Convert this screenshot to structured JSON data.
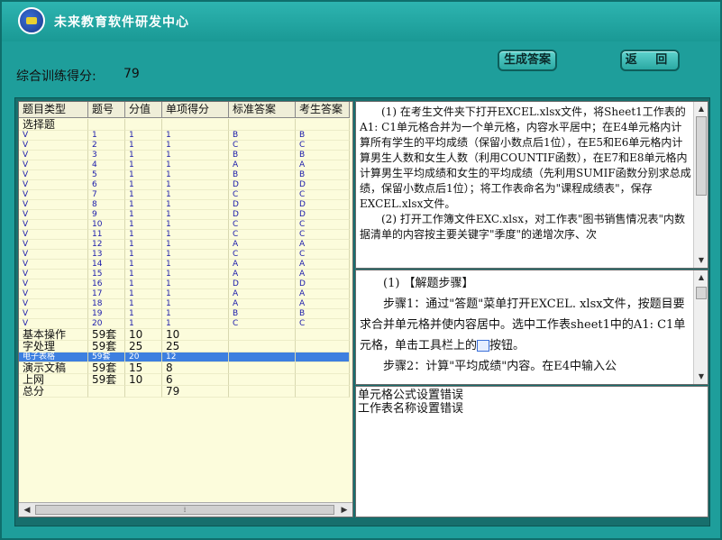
{
  "app": {
    "title": "未来教育软件研发中心"
  },
  "score": {
    "label": "综合训练得分:",
    "value": "79"
  },
  "toolbar": {
    "generate_label": "生成答案",
    "return_label": "返 回"
  },
  "grid": {
    "columns": [
      "题目类型",
      "题号",
      "分值",
      "单项得分",
      "标准答案",
      "考生答案"
    ],
    "rows": [
      {
        "type": "选择题",
        "num": "",
        "score": "",
        "got": "",
        "std": "",
        "ans": "",
        "kind": "cat"
      },
      {
        "type": "V",
        "num": "1",
        "score": "1",
        "got": "1",
        "std": "B",
        "ans": "B",
        "kind": "sub"
      },
      {
        "type": "V",
        "num": "2",
        "score": "1",
        "got": "1",
        "std": "C",
        "ans": "C",
        "kind": "sub"
      },
      {
        "type": "V",
        "num": "3",
        "score": "1",
        "got": "1",
        "std": "B",
        "ans": "B",
        "kind": "sub"
      },
      {
        "type": "V",
        "num": "4",
        "score": "1",
        "got": "1",
        "std": "A",
        "ans": "A",
        "kind": "sub"
      },
      {
        "type": "V",
        "num": "5",
        "score": "1",
        "got": "1",
        "std": "B",
        "ans": "B",
        "kind": "sub"
      },
      {
        "type": "V",
        "num": "6",
        "score": "1",
        "got": "1",
        "std": "D",
        "ans": "D",
        "kind": "sub"
      },
      {
        "type": "V",
        "num": "7",
        "score": "1",
        "got": "1",
        "std": "C",
        "ans": "C",
        "kind": "sub"
      },
      {
        "type": "V",
        "num": "8",
        "score": "1",
        "got": "1",
        "std": "D",
        "ans": "D",
        "kind": "sub"
      },
      {
        "type": "V",
        "num": "9",
        "score": "1",
        "got": "1",
        "std": "D",
        "ans": "D",
        "kind": "sub"
      },
      {
        "type": "V",
        "num": "10",
        "score": "1",
        "got": "1",
        "std": "C",
        "ans": "C",
        "kind": "sub"
      },
      {
        "type": "V",
        "num": "11",
        "score": "1",
        "got": "1",
        "std": "C",
        "ans": "C",
        "kind": "sub"
      },
      {
        "type": "V",
        "num": "12",
        "score": "1",
        "got": "1",
        "std": "A",
        "ans": "A",
        "kind": "sub"
      },
      {
        "type": "V",
        "num": "13",
        "score": "1",
        "got": "1",
        "std": "C",
        "ans": "C",
        "kind": "sub"
      },
      {
        "type": "V",
        "num": "14",
        "score": "1",
        "got": "1",
        "std": "A",
        "ans": "A",
        "kind": "sub"
      },
      {
        "type": "V",
        "num": "15",
        "score": "1",
        "got": "1",
        "std": "A",
        "ans": "A",
        "kind": "sub"
      },
      {
        "type": "V",
        "num": "16",
        "score": "1",
        "got": "1",
        "std": "D",
        "ans": "D",
        "kind": "sub"
      },
      {
        "type": "V",
        "num": "17",
        "score": "1",
        "got": "1",
        "std": "A",
        "ans": "A",
        "kind": "sub"
      },
      {
        "type": "V",
        "num": "18",
        "score": "1",
        "got": "1",
        "std": "A",
        "ans": "A",
        "kind": "sub"
      },
      {
        "type": "V",
        "num": "19",
        "score": "1",
        "got": "1",
        "std": "B",
        "ans": "B",
        "kind": "sub"
      },
      {
        "type": "V",
        "num": "20",
        "score": "1",
        "got": "1",
        "std": "C",
        "ans": "C",
        "kind": "sub"
      },
      {
        "type": "基本操作",
        "num": "59套",
        "score": "10",
        "got": "10",
        "std": "",
        "ans": "",
        "kind": "cat"
      },
      {
        "type": "字处理",
        "num": "59套",
        "score": "25",
        "got": "25",
        "std": "",
        "ans": "",
        "kind": "cat"
      },
      {
        "type": "电子表格",
        "num": "59套",
        "score": "20",
        "got": "12",
        "std": "",
        "ans": "",
        "kind": "sel"
      },
      {
        "type": "演示文稿",
        "num": "59套",
        "score": "15",
        "got": "8",
        "std": "",
        "ans": "",
        "kind": "cat"
      },
      {
        "type": "上网",
        "num": "59套",
        "score": "10",
        "got": "6",
        "std": "",
        "ans": "",
        "kind": "cat"
      },
      {
        "type": "总分",
        "num": "",
        "score": "",
        "got": "79",
        "std": "",
        "ans": "",
        "kind": "cat"
      }
    ],
    "scroll_thumb_glyph": "⁞"
  },
  "question": {
    "paragraphs": [
      "(1) 在考生文件夹下打开EXCEL.xlsx文件，将Sheet1工作表的A1: C1单元格合并为一个单元格，内容水平居中；在E4单元格内计算所有学生的平均成绩（保留小数点后1位），在E5和E6单元格内计算男生人数和女生人数（利用COUNTIF函数），在E7和E8单元格内计算男生平均成绩和女生的平均成绩（先利用SUMIF函数分别求总成绩，保留小数点后1位）；将工作表命名为\"课程成绩表\"，保存EXCEL.xlsx文件。",
      "(2) 打开工作簿文件EXC.xlsx，对工作表\"图书销售情况表\"内数据清单的内容按主要关键字\"季度\"的递增次序、次"
    ]
  },
  "answer": {
    "heading": "(1) 【解题步骤】",
    "step1_before": "步骤1：通过\"答题\"菜单打开EXCEL. xlsx文件，按题目要求合并单元格并使内容居中。选中工作表sheet1中的A1: C1单元格，单击工具栏上的",
    "step1_after": "按钮。",
    "step2": "步骤2：计算\"平均成绩\"内容。在E4中输入公"
  },
  "errors": [
    "单元格公式设置错误",
    "工作表名称设置错误"
  ],
  "colors": {
    "background": "#1e9e9b",
    "selection": "#3d7fe0",
    "grid_bg": "#fcfcdc"
  },
  "icons": [
    "logo-icon",
    "merge-center-icon"
  ]
}
